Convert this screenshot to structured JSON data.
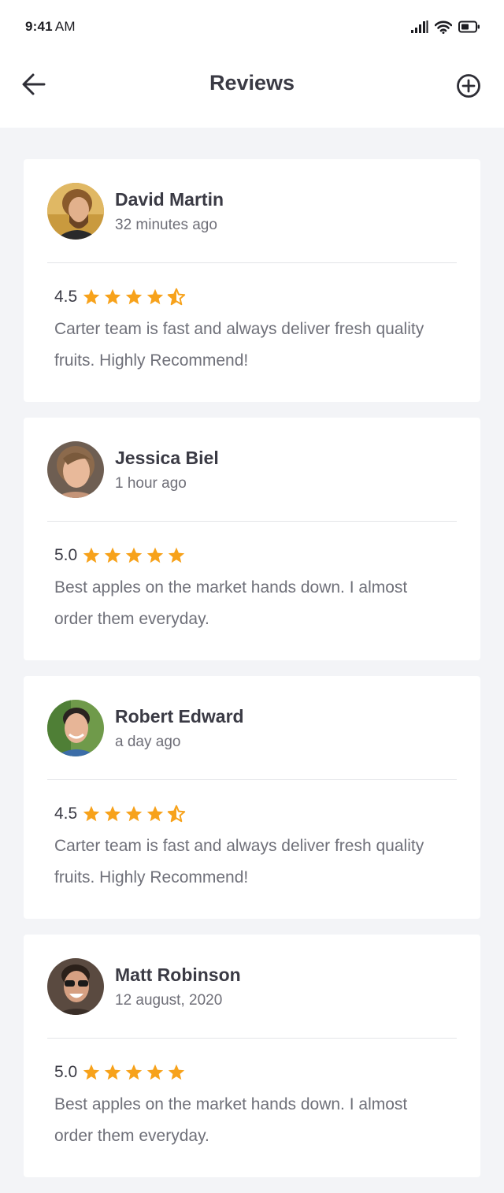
{
  "statusbar": {
    "time": "9:41",
    "ampm": "AM"
  },
  "header": {
    "title": "Reviews"
  },
  "colors": {
    "star": "#f7a21b",
    "background": "#f3f4f7",
    "card": "#ffffff"
  },
  "reviews": [
    {
      "name": "David Martin",
      "time": "32 minutes ago",
      "rating_label": "4.5",
      "rating": 4.5,
      "text": "Carter team is fast and always deliver fresh quality fruits. Highly Recommend!"
    },
    {
      "name": "Jessica Biel",
      "time": "1 hour ago",
      "rating_label": "5.0",
      "rating": 5.0,
      "text": "Best apples on the market hands down. I almost order them everyday."
    },
    {
      "name": "Robert Edward",
      "time": "a day ago",
      "rating_label": "4.5",
      "rating": 4.5,
      "text": "Carter team is fast and always deliver fresh quality fruits. Highly Recommend!"
    },
    {
      "name": "Matt Robinson",
      "time": "12 august, 2020",
      "rating_label": "5.0",
      "rating": 5.0,
      "text": "Best apples on the market hands down. I almost order them everyday."
    }
  ]
}
